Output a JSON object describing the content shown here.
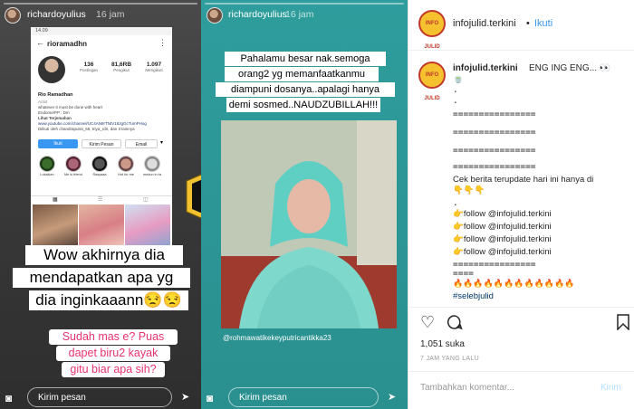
{
  "story1": {
    "username": "richardoyulius",
    "time": "16 jam",
    "phone": {
      "status_time": "14.09",
      "username": "rioramadhn",
      "stats": [
        {
          "value": "136",
          "label": "Postingan"
        },
        {
          "value": "81,6RB",
          "label": "Pengikut"
        },
        {
          "value": "1.097",
          "label": "Mengikuti"
        }
      ],
      "bio_name": "Rio Ramadhan",
      "bio_lines": [
        "Artist",
        "whatever it must be done with heart",
        "Endorse/PP : Dm",
        "Lihat Terjemahan",
        "www.youtube.com/channel/UC4AN8rTNtV18JgGcTumPHog",
        "Diikuti oleh chandraputra_68, triya_rdn, dan 3 lainnya"
      ],
      "buttons": [
        "Ikuti",
        "Kirim Pesan",
        "Email"
      ],
      "highlights": [
        "Lokalkan",
        "Me is friends",
        "Rasyaaa",
        "Hot for me",
        "medun in be"
      ]
    },
    "caption_main": [
      "Wow akhirnya dia",
      "mendapatkan apa yg",
      "dia inginkaaann😒😒"
    ],
    "caption_pink": [
      "Sudah mas e? Puas",
      "dapet biru2 kayak",
      "gitu biar apa sih?"
    ],
    "reply_placeholder": "Kirim pesan"
  },
  "logo_center": [
    "Seleb",
    "Julid"
  ],
  "story2": {
    "username": "richardoyulius",
    "time": "16 jam",
    "caption": [
      "Pahalamu besar nak.semoga",
      "orang2 yg memanfaatkanmu",
      "diampuni dosanya..apalagi hanya",
      "demi sosmed..NAUDZUBILLAH!!!"
    ],
    "watermark": "@rohmawatikekeyputricantikka23",
    "reply_placeholder": "Kirim pesan"
  },
  "post": {
    "header_user": "infojulid.terkini",
    "follow": "Ikuti",
    "avatar_text": "INFO JULID",
    "caption_user": "infojulid.terkini",
    "caption_first": "ENG ING ENG... 👀",
    "caption_lines": [
      "🍵",
      ".",
      ".",
      "================",
      "================",
      "================",
      "================",
      "Cek berita terupdate hari ini hanya di",
      "👇👇👇",
      ".",
      "👉follow @infojulid.terkini",
      "👉follow @infojulid.terkini",
      "👉follow @infojulid.terkini",
      "👉follow @infojulid.terkini",
      "================",
      "====",
      "🔥🔥🔥🔥🔥🔥🔥🔥🔥🔥🔥🔥",
      "#selebjulid"
    ],
    "likes": "1,051 suka",
    "time_ago": "7 JAM YANG LALU",
    "comment_placeholder": "Tambahkan komentar...",
    "post_button": "Kirim"
  }
}
